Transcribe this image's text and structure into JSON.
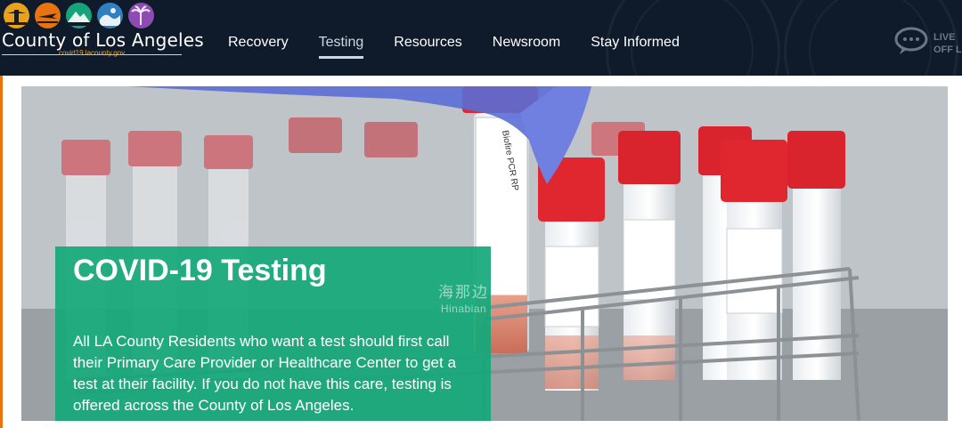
{
  "header": {
    "logo": {
      "title": "County of Los Angeles",
      "url": "covid19.lacounty.gov",
      "icons": [
        "lighthouse-icon",
        "sunset-plane-icon",
        "mountain-icon",
        "wave-icon",
        "palm-tree-icon"
      ],
      "icon_colors": [
        "#e8a21b",
        "#e8730f",
        "#16a37a",
        "#2f7fc1",
        "#8e4bb4"
      ]
    },
    "nav": [
      {
        "label": "Recovery",
        "active": false
      },
      {
        "label": "Testing",
        "active": true
      },
      {
        "label": "Resources",
        "active": false
      },
      {
        "label": "Newsroom",
        "active": false
      },
      {
        "label": "Stay Informed",
        "active": false
      }
    ],
    "live_chat": {
      "line1": "LIVE",
      "line2": "OFF L",
      "icon": "chat-bubble-icon"
    }
  },
  "hero": {
    "title": "COVID-19 Testing",
    "body": "All LA County Residents who want a test should first call their Primary Care Provider or Healthcare Center to get a test at their facility. If you do not have this care, testing is offered across the County of Los Angeles.",
    "overlay_color": "#14a878"
  },
  "watermark": {
    "line1": "海那边",
    "line2": "Hinabian"
  }
}
